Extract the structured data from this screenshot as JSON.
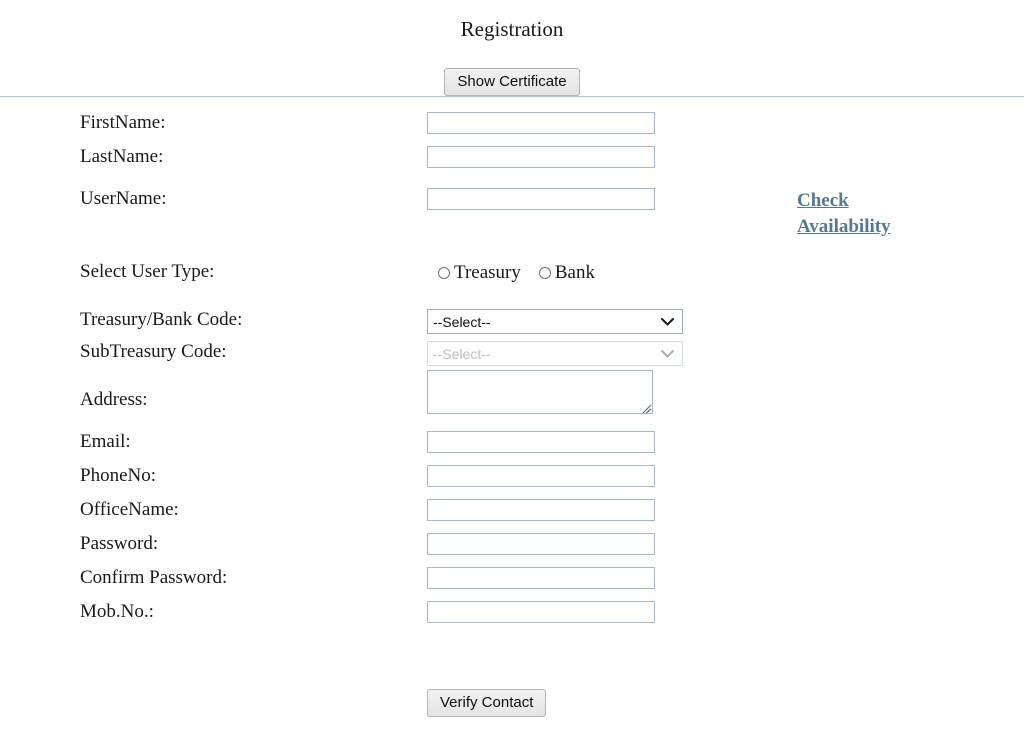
{
  "page": {
    "title": "Registration"
  },
  "toolbar": {
    "show_certificate_label": "Show Certificate"
  },
  "links": {
    "check_availability_label": "Check Availability"
  },
  "form": {
    "fields": [
      {
        "label": "FirstName:",
        "value": "",
        "placeholder": ""
      },
      {
        "label": "LastName:",
        "value": "",
        "placeholder": ""
      },
      {
        "label": "UserName:",
        "value": "",
        "placeholder": ""
      },
      {
        "label": "Email:",
        "value": "",
        "placeholder": ""
      },
      {
        "label": "PhoneNo:",
        "value": "",
        "placeholder": ""
      },
      {
        "label": "OfficeName:",
        "value": "",
        "placeholder": ""
      },
      {
        "label": "Password:",
        "value": "",
        "placeholder": ""
      },
      {
        "label": "Confirm Password:",
        "value": "",
        "placeholder": ""
      },
      {
        "label": "Mob.No.:",
        "value": "",
        "placeholder": ""
      }
    ],
    "user_type": {
      "label": "Select User Type:",
      "options": [
        {
          "label": "Treasury",
          "selected": false
        },
        {
          "label": "Bank",
          "selected": false
        }
      ]
    },
    "treasury_bank_code": {
      "label": "Treasury/Bank Code:",
      "selected": "--Select--",
      "disabled": false
    },
    "sub_treasury_code": {
      "label": "SubTreasury Code:",
      "selected": "--Select--",
      "disabled": true
    },
    "address": {
      "label": "Address:",
      "value": "",
      "placeholder": ""
    }
  },
  "actions": {
    "verify_contact_label": "Verify Contact"
  },
  "colors": {
    "link": "#56798f",
    "input_border": "#a7b8c5",
    "rule": "#b9c7d2",
    "text": "#1a1a1a",
    "button_face": "#ebebeb"
  }
}
